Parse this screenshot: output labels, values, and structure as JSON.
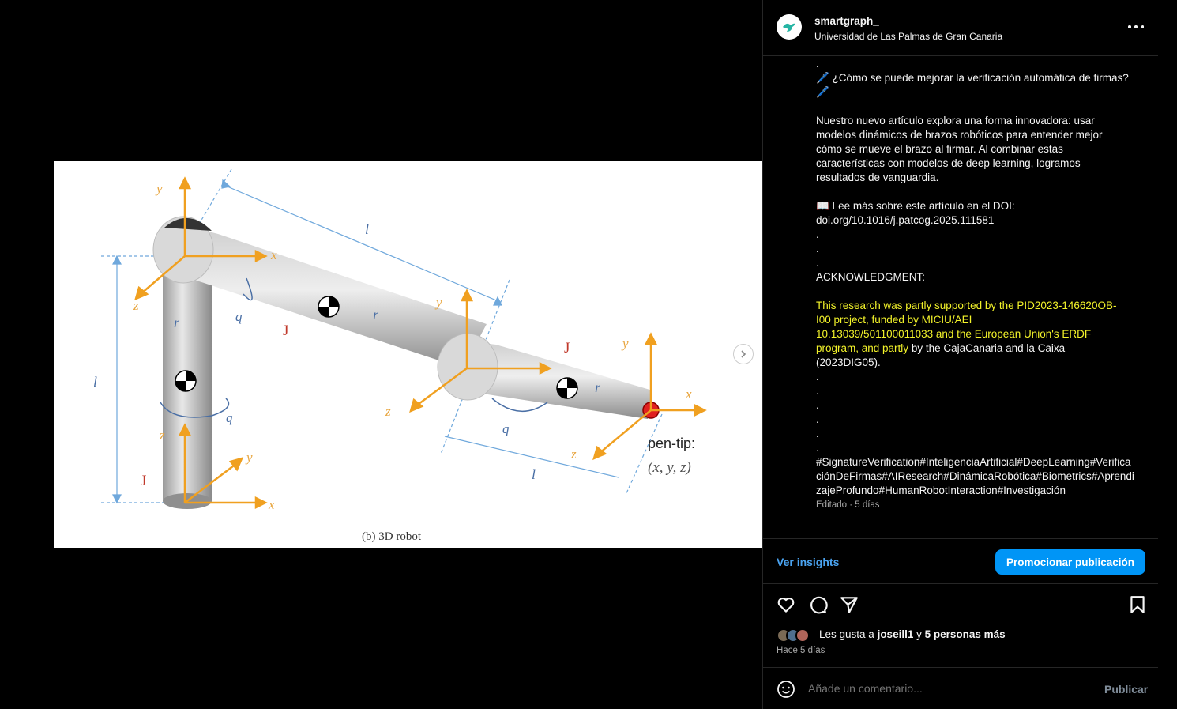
{
  "post": {
    "username": "smartgraph_",
    "location": "Universidad de Las Palmas de Gran Canaria",
    "caption_lines": [
      ".",
      "🖊️ ¿Cómo se puede mejorar la verificación automática de firmas?",
      "🖊️",
      "",
      "Nuestro nuevo artículo explora una forma innovadora: usar",
      "modelos dinámicos de brazos robóticos para entender mejor",
      "cómo se mueve el brazo al firmar. Al combinar estas",
      "características con modelos de deep learning, logramos",
      "resultados de vanguardia.",
      "",
      "📖 Lee más sobre este artículo en el DOI:",
      "doi.org/10.1016/j.patcog.2025.111581",
      ".",
      ".",
      ".",
      "ACKNOWLEDGMENT:",
      ""
    ],
    "ack_highlight_lines": [
      "This research was partly supported by the PID2023-146620OB-",
      "I00 project, funded by MICIU/AEI",
      "10.13039/501100011033 and the European Union's ERDF"
    ],
    "ack_mixed_line_highlight": "program, and partly",
    "ack_mixed_line_plain": " by the CajaCanaria and la Caixa",
    "ack_end": "(2023DIG05).",
    "dots_after": [
      ".",
      ".",
      ".",
      ".",
      ".",
      "."
    ],
    "hashtags": "#SignatureVerification#InteligenciaArtificial#DeepLearning#VerificaciónDeFirmas#AIResearch#DinámicaRobótica#Biometrics#AprendizajeProfundo#HumanRobotInteraction#Investigación",
    "edited": "Editado · 5 días",
    "insights_label": "Ver insights",
    "promote_label": "Promocionar publicación",
    "likes_prefix": "Les gusta a ",
    "likes_user": "joseill1",
    "likes_mid": " y ",
    "likes_others": "5 personas más",
    "time_ago": "Hace 5 días",
    "comment_placeholder": "Añade un comentario...",
    "publish_label": "Publicar"
  },
  "figure": {
    "caption": "(b) 3D robot",
    "pen_tip_label": "pen-tip:",
    "pen_tip_coords": "(x, y, z)",
    "joint_labels": [
      "J1",
      "J2",
      "J3"
    ],
    "length_labels": [
      "l1",
      "l2",
      "l3"
    ],
    "angle_labels": [
      "q1",
      "q2",
      "q3"
    ],
    "axis_labels": [
      "y1",
      "z1",
      "x1",
      "y2",
      "z2",
      "x2",
      "y3",
      "z3",
      "x3",
      "z0",
      "y0",
      "x0"
    ],
    "r_labels": [
      "1r1",
      "2r2",
      "3r3"
    ]
  },
  "colors": {
    "accent": "#0095f6",
    "link": "#4aa3f0",
    "highlight": "#f3f32a",
    "axis_orange": "#f0a020",
    "dim_blue": "#6fa8dc",
    "joint_red": "#c0392b"
  },
  "icons": [
    "heart-icon",
    "comment-icon",
    "share-icon",
    "bookmark-icon",
    "more-options-icon",
    "emoji-icon",
    "chevron-right-icon"
  ]
}
